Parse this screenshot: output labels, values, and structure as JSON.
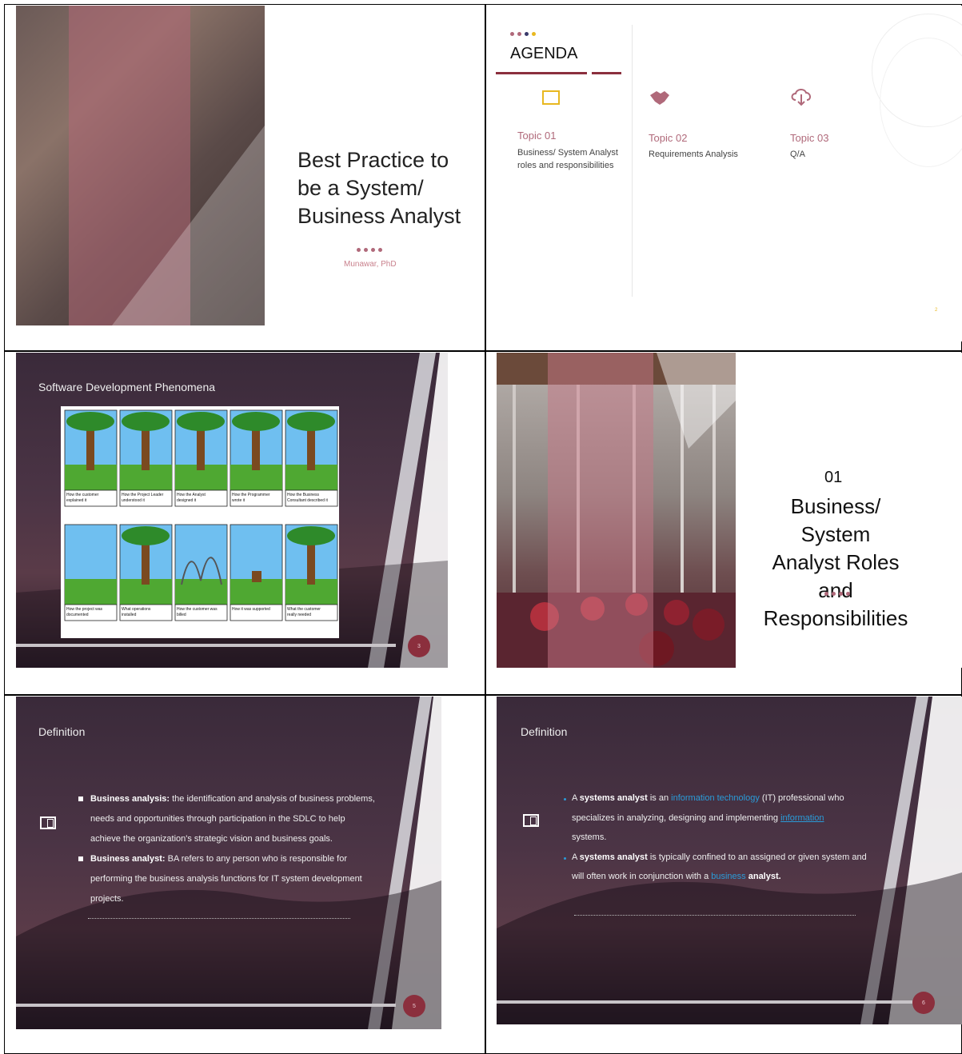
{
  "slide1": {
    "title_lines": [
      "Best Practice to",
      "be a System/",
      "Business Analyst"
    ],
    "author": "Munawar, PhD"
  },
  "slide2": {
    "heading": "AGENDA",
    "topics": [
      {
        "label": "Topic 01",
        "desc_lines": [
          "Business/ System Analyst",
          "roles and responsibilities"
        ],
        "icon": "book-icon"
      },
      {
        "label": "Topic 02",
        "desc_lines": [
          "Requirements Analysis"
        ],
        "icon": "handshake-icon"
      },
      {
        "label": "Topic 03",
        "desc_lines": [
          "Q/A"
        ],
        "icon": "cloud-download-icon"
      }
    ],
    "page_number": "2"
  },
  "slide3": {
    "title": "Software Development Phenomena",
    "captions": [
      "How the customer explained it",
      "How the Project Leader understood it",
      "How the Analyst designed it",
      "How the Programmer wrote it",
      "How the Business Consultant described it",
      "How the project was documented",
      "What operations installed",
      "How the customer was billed",
      "How it was supported",
      "What the customer really needed"
    ],
    "page_number": "3"
  },
  "slide4": {
    "number": "01",
    "title_lines": [
      "Business/ System",
      "Analyst Roles and",
      "Responsibilities"
    ]
  },
  "slide5": {
    "title": "Definition",
    "b1_term": "Business analysis:",
    "b1_rest": " the identification and analysis of business  problems,",
    "b1_line2": "needs and opportunities through participation in  the SDLC to help",
    "b1_line3": "achieve the organization's strategic vision  and business goals.",
    "b2_term": "Business analyst:",
    "b2_rest": " BA refers to any person who is responsible  for",
    "b2_line2": "performing the business analysis functions for IT system  development",
    "b2_line3": "projects.",
    "page_number": "5"
  },
  "slide6": {
    "title": "Definition",
    "p1_a": "A ",
    "p1_term": "systems analyst",
    "p1_b": " is an ",
    "p1_link1": "information technology",
    "p1_c": " (IT)  professional who",
    "p1_line2a": "specializes in analyzing, designing and  implementing ",
    "p1_link2": "information",
    "p1_line3": "systems.",
    "p2_a": "A ",
    "p2_term": "systems analyst",
    "p2_b": " is typically confined to an assigned or  given system and",
    "p2_line2a": "will often work in conjunction with a ",
    "p2_link": "business",
    "p2_term2": " analyst.",
    "page_number": "6"
  },
  "colors": {
    "accent": "#8b2f3d",
    "rose": "#c9818d",
    "dark_bg": "#3d2b3b"
  }
}
